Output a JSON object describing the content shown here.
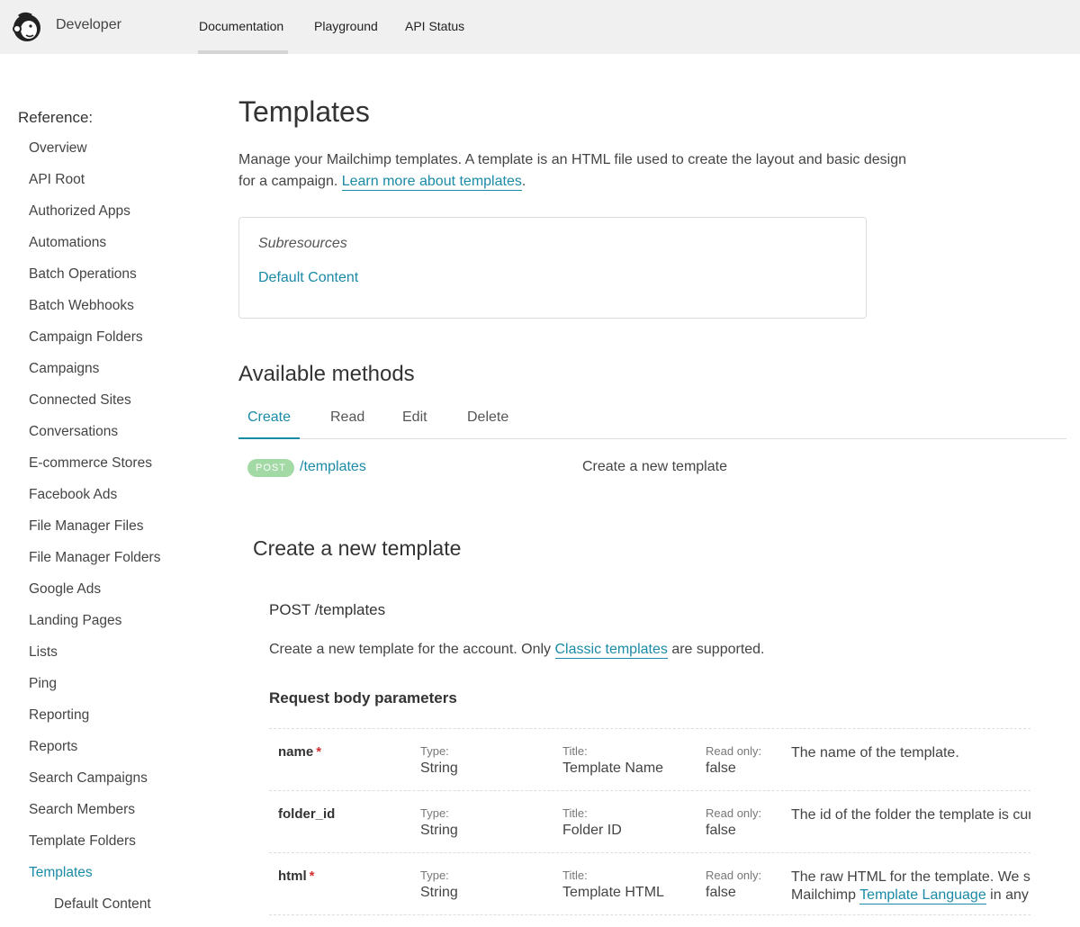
{
  "header": {
    "brand": "Developer",
    "nav": [
      "Documentation",
      "Playground",
      "API Status"
    ]
  },
  "sidebar": {
    "heading": "Reference:",
    "items": [
      "Overview",
      "API Root",
      "Authorized Apps",
      "Automations",
      "Batch Operations",
      "Batch Webhooks",
      "Campaign Folders",
      "Campaigns",
      "Connected Sites",
      "Conversations",
      "E-commerce Stores",
      "Facebook Ads",
      "File Manager Files",
      "File Manager Folders",
      "Google Ads",
      "Landing Pages",
      "Lists",
      "Ping",
      "Reporting",
      "Reports",
      "Search Campaigns",
      "Search Members",
      "Template Folders",
      "Templates",
      "Default Content"
    ],
    "active": "Templates"
  },
  "main": {
    "title": "Templates",
    "intro": "Manage your Mailchimp templates. A template is an HTML file used to create the layout and basic design for a campaign.",
    "intro_link": "Learn more about templates",
    "intro_end": ".",
    "subresources_title": "Subresources",
    "subresources_link": "Default Content",
    "methods_title": "Available methods",
    "tabs": [
      "Create",
      "Read",
      "Edit",
      "Delete"
    ],
    "method": {
      "verb": "POST",
      "path": "/templates",
      "desc": "Create a new template"
    },
    "section_title": "Create a new template",
    "post_line": "POST /templates",
    "post_desc_before": "Create a new template for the account. Only ",
    "post_desc_link": "Classic templates",
    "post_desc_after": " are supported.",
    "request_title": "Request body parameters",
    "param_labels": {
      "type": "Type:",
      "title": "Title:",
      "readonly": "Read only:"
    },
    "params": [
      {
        "name": "name",
        "required": "*",
        "type": "String",
        "title": "Template Name",
        "readonly": "false",
        "desc": "The name of the template."
      },
      {
        "name": "folder_id",
        "required": "",
        "type": "String",
        "title": "Folder ID",
        "readonly": "false",
        "desc": "The id of the folder the template is cur"
      },
      {
        "name": "html",
        "required": "*",
        "type": "String",
        "title": "Template HTML",
        "readonly": "false",
        "desc": "The raw HTML for the template. We su",
        "desc2_before": "Mailchimp ",
        "desc2_link": "Template Language",
        "desc2_after": " in any t"
      }
    ]
  }
}
